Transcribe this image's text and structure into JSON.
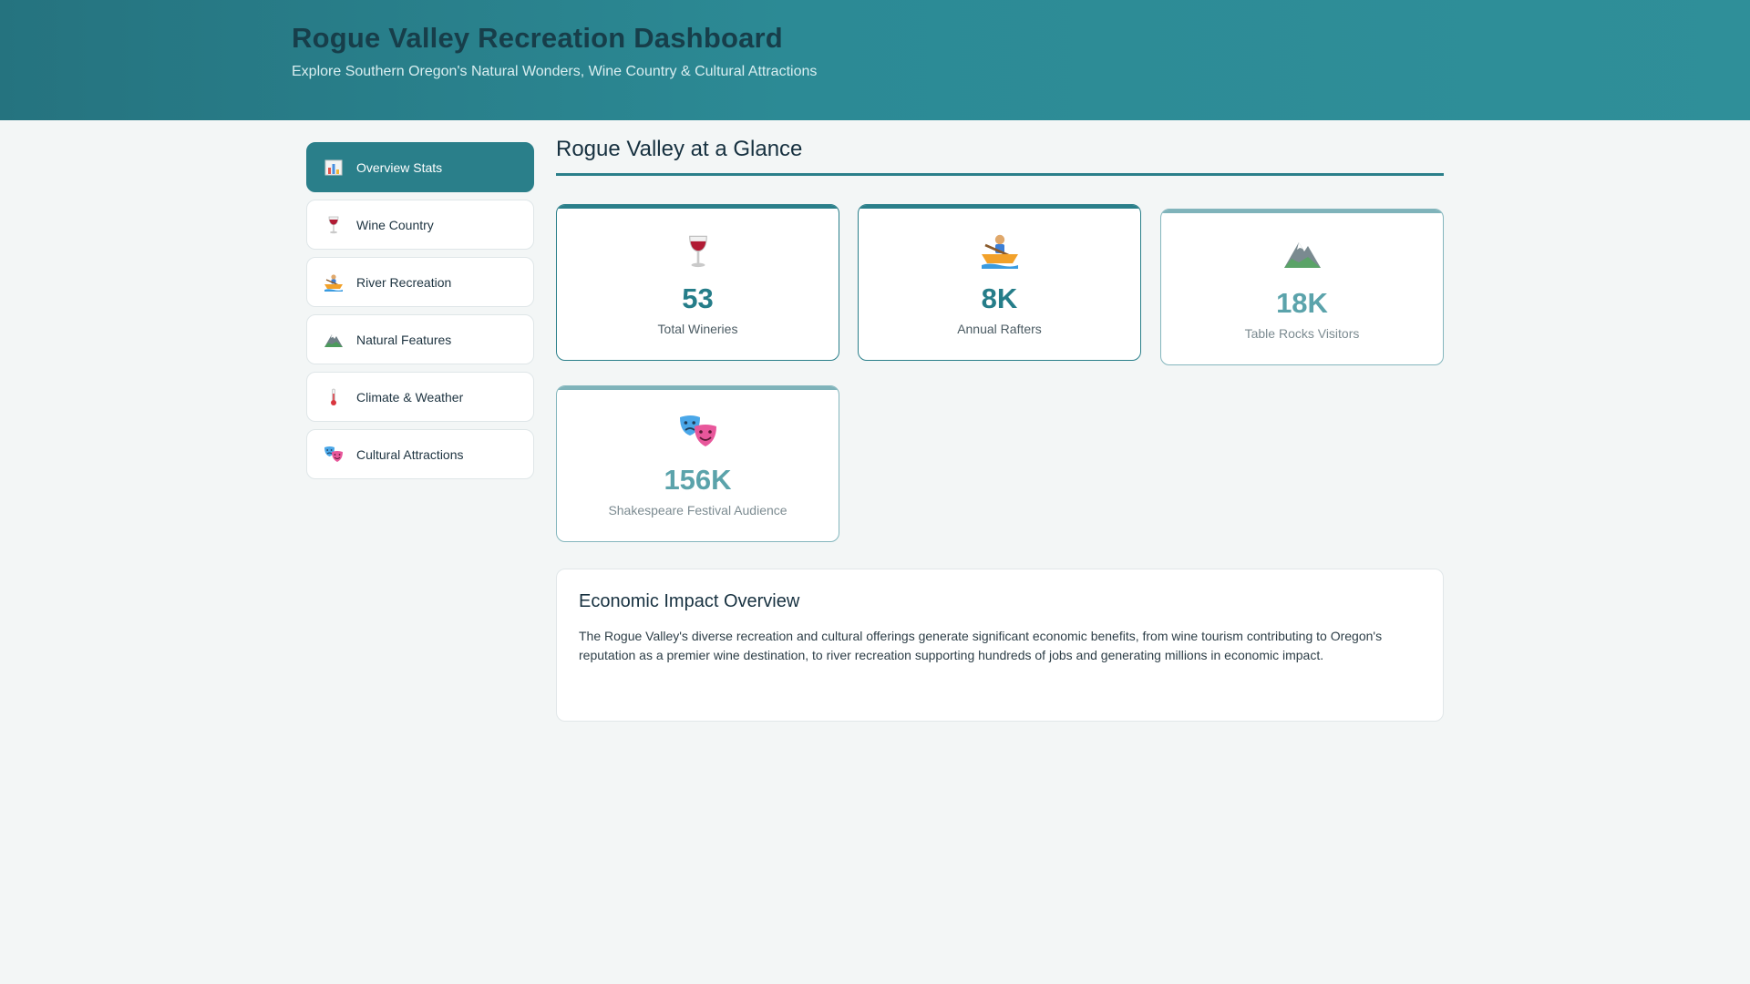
{
  "header": {
    "title": "Rogue Valley Recreation Dashboard",
    "subtitle": "Explore Southern Oregon's Natural Wonders, Wine Country & Cultural Attractions"
  },
  "sidebar": {
    "items": [
      {
        "label": "Overview Stats",
        "icon": "bar-chart-icon",
        "active": true
      },
      {
        "label": "Wine Country",
        "icon": "wine-glass-icon",
        "active": false
      },
      {
        "label": "River Recreation",
        "icon": "rowboat-icon",
        "active": false
      },
      {
        "label": "Natural Features",
        "icon": "mountain-icon",
        "active": false
      },
      {
        "label": "Climate & Weather",
        "icon": "thermometer-icon",
        "active": false
      },
      {
        "label": "Cultural Attractions",
        "icon": "theater-masks-icon",
        "active": false
      }
    ]
  },
  "main": {
    "title": "Rogue Valley at a Glance",
    "stats": [
      {
        "value": "53",
        "label": "Total Wineries",
        "icon": "wine-glass-icon"
      },
      {
        "value": "8K",
        "label": "Annual Rafters",
        "icon": "rowboat-icon"
      },
      {
        "value": "18K",
        "label": "Table Rocks Visitors",
        "icon": "mountain-icon"
      },
      {
        "value": "156K",
        "label": "Shakespeare Festival Audience",
        "icon": "theater-masks-icon"
      }
    ],
    "impact": {
      "title": "Economic Impact Overview",
      "text": "The Rogue Valley's diverse recreation and cultural offerings generate significant economic benefits, from wine tourism contributing to Oregon's reputation as a premier wine destination, to river recreation supporting hundreds of jobs and generating millions in economic impact."
    }
  },
  "colors": {
    "accent": "#2a7f8a",
    "header_start": "#25737f",
    "header_end": "#2f8f99"
  }
}
